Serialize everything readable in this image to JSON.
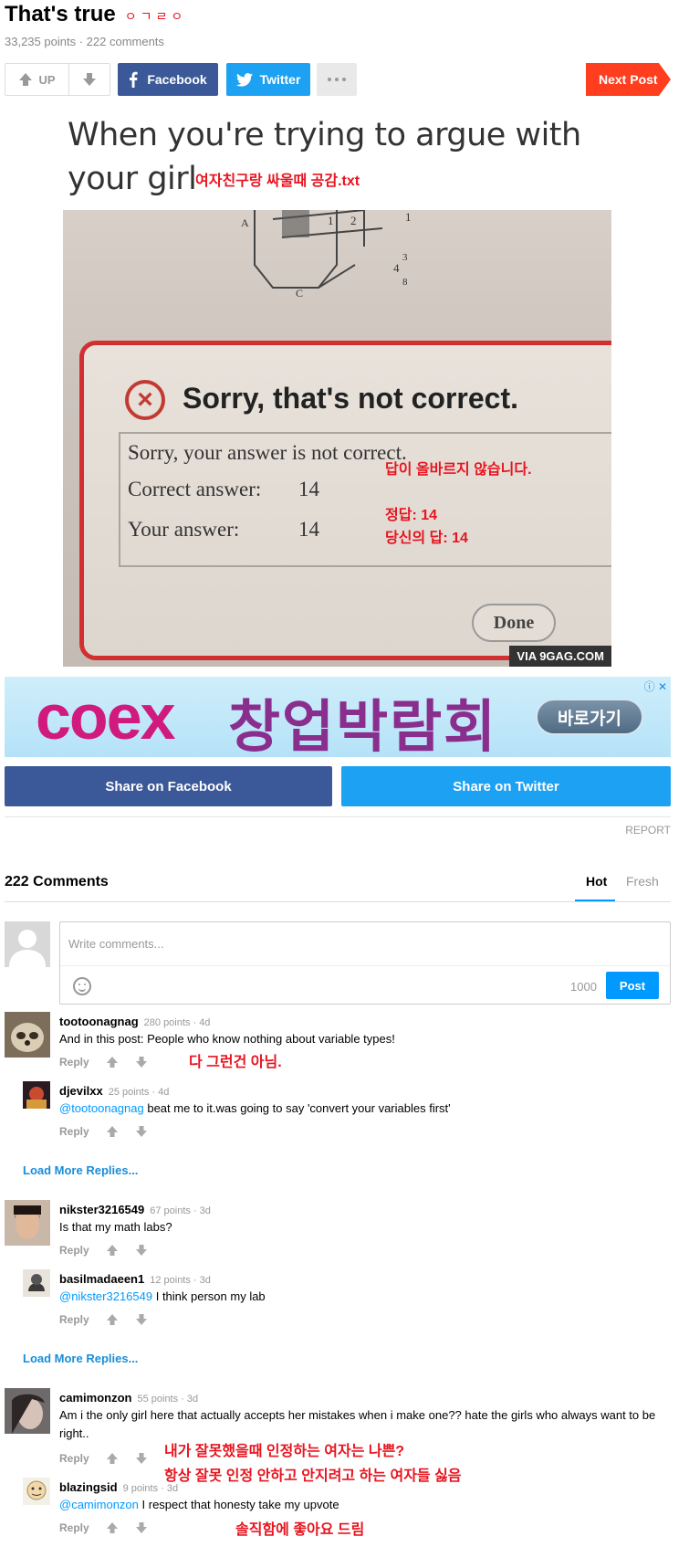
{
  "post": {
    "title": "That's true",
    "title_note": "ㅇㄱㄹㅇ",
    "points": "33,235 points",
    "comments": "222 comments"
  },
  "actions": {
    "up_label": "UP",
    "facebook_label": "Facebook",
    "twitter_label": "Twitter",
    "next_label": "Next Post"
  },
  "image": {
    "caption_en": "When you're trying to argue with your girl",
    "caption_kr": "여자친구랑 싸울때 공감.txt",
    "dialog_title": "Sorry, that's not correct.",
    "line1": "Sorry, your answer is not correct.",
    "line2_label": "Correct answer:",
    "line2_value": "14",
    "line3_label": "Your answer:",
    "line3_value": "14",
    "kr_line1": "답이 올바르지 않습니다.",
    "kr_line2": "정답: 14",
    "kr_line3": "당신의 답: 14",
    "done_label": "Done",
    "watermark": "VIA 9GAG.COM",
    "sketch_numbers": [
      "1",
      "2",
      "3",
      "4",
      "3",
      "8",
      "A",
      "C"
    ]
  },
  "ad": {
    "brand": "coex",
    "title": "창업박람회",
    "cta": "바로가기"
  },
  "share": {
    "facebook": "Share on Facebook",
    "twitter": "Share on Twitter",
    "report": "REPORT"
  },
  "comments_section": {
    "count_label": "222 Comments",
    "tab_hot": "Hot",
    "tab_fresh": "Fresh",
    "input_placeholder": "Write comments...",
    "char_limit": "1000",
    "post_label": "Post",
    "reply_label": "Reply",
    "load_more": "Load More Replies..."
  },
  "comments": [
    {
      "user": "tootoonagnag",
      "meta": "280 points · 4d",
      "text": "And in this post: People who know nothing about variable types!",
      "kr_note": "다 그런건 아님.",
      "reply": {
        "user": "djevilxx",
        "meta": "25 points · 4d",
        "mention": "@tootoonagnag",
        "text": " beat me to it.was going to say 'convert your variables first'"
      }
    },
    {
      "user": "nikster3216549",
      "meta": "67 points · 3d",
      "text": "Is that my math labs?",
      "reply": {
        "user": "basilmadaeen1",
        "meta": "12 points · 3d",
        "mention": "@nikster3216549",
        "text": " I think person my lab"
      }
    },
    {
      "user": "camimonzon",
      "meta": "55 points · 3d",
      "text": "Am i the only girl here that actually accepts her mistakes when i make one?? hate the girls who always want to be right..",
      "kr_note1": "내가 잘못했을때 인정하는 여자는 나쁜?",
      "kr_note2": "항상 잘못 인정 안하고 안지려고 하는 여자들 싫음",
      "reply": {
        "user": "blazingsid",
        "meta": "9 points · 3d",
        "mention": "@camimonzon",
        "text": " I respect that honesty take my upvote",
        "kr_note": "솔직함에 좋아요 드림"
      }
    }
  ],
  "colors": {
    "facebook": "#3b5998",
    "twitter": "#1da1f2",
    "next": "#ff3d1f",
    "accent": "#0099ff",
    "korean_note": "#e8141f",
    "link": "#1a8dd8"
  }
}
